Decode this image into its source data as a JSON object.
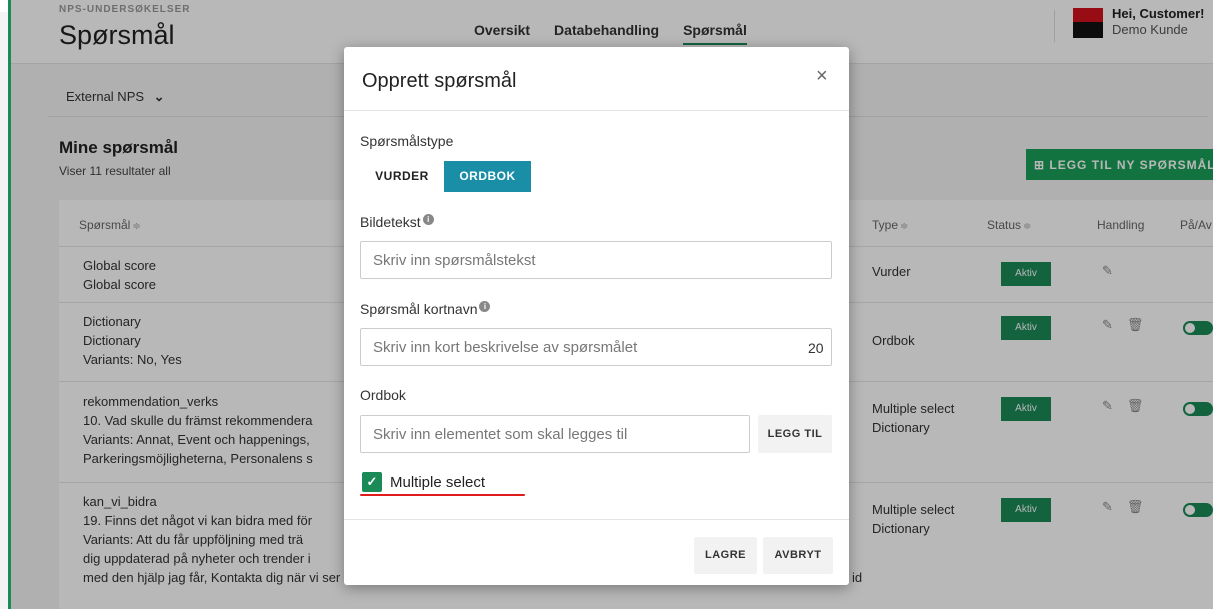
{
  "header": {
    "crumb": "NPS-UNDERSØKELSER",
    "title": "Spørsmål",
    "nav": [
      "Oversikt",
      "Databehandling",
      "Spørsmål"
    ],
    "user_greeting": "Hei, Customer!",
    "user_name": "Demo Kunde"
  },
  "filter": {
    "label": "External NPS",
    "caret": "⌄"
  },
  "section": {
    "title": "Mine spørsmål",
    "subtitle": "Viser 11 resultater all",
    "add_button": "⊞ LEGG TIL NY SPØRSMÅL"
  },
  "table": {
    "headers": {
      "question": "Spørsmål",
      "type": "Type",
      "status": "Status",
      "action": "Handling",
      "onoff": "På/Av"
    },
    "sort_icon": "≑",
    "rows": [
      {
        "lines": [
          "Global score",
          "Global score"
        ],
        "type_lines": [
          "Vurder"
        ],
        "status": "Aktiv"
      },
      {
        "lines": [
          "Dictionary",
          "Dictionary",
          "Variants: No, Yes"
        ],
        "type_lines": [
          "Ordbok"
        ],
        "status": "Aktiv"
      },
      {
        "lines": [
          "rekommendation_verks",
          "10. Vad skulle du främst rekommendera",
          "Variants: Annat, Event och happenings,",
          "Parkeringsmöjligheterna, Personalens s"
        ],
        "type_lines": [
          "Multiple select",
          "Dictionary"
        ],
        "status": "Aktiv"
      },
      {
        "lines": [
          "kan_vi_bidra",
          "19. Finns det något vi kan bidra med för",
          "Variants: Att du får uppföljning med trä",
          "dig uppdaterad på nyheter och trender i",
          "med den hjälp jag får, Kontakta dig när vi ser att du uteblir från träningen"
        ],
        "tail": "id",
        "type_lines": [
          "Multiple select",
          "Dictionary"
        ],
        "status": "Aktiv"
      }
    ]
  },
  "modal": {
    "title": "Opprett spørsmål",
    "close": "×",
    "type_label": "Spørsmålstype",
    "type_options": [
      "VURDER",
      "ORDBOK"
    ],
    "selected_type": "ORDBOK",
    "caption_label": "Bildetekst",
    "caption_placeholder": "Skriv inn spørsmålstekst",
    "shortname_label": "Spørsmål kortnavn",
    "shortname_placeholder": "Skriv inn kort beskrivelse av spørsmålet",
    "shortname_counter": "20",
    "dictionary_label": "Ordbok",
    "dictionary_placeholder": "Skriv inn elementet som skal legges til",
    "add_button": "LEGG TIL",
    "multiple_select_label": "Multiple select",
    "multiple_select_checked": true,
    "save_button": "LAGRE",
    "cancel_button": "AVBRYT",
    "info_glyph": "i"
  },
  "colors": {
    "brand_green": "#1a8a57",
    "ordbok_teal": "#1a8ea6",
    "annotation_red": "#e01b1b"
  }
}
